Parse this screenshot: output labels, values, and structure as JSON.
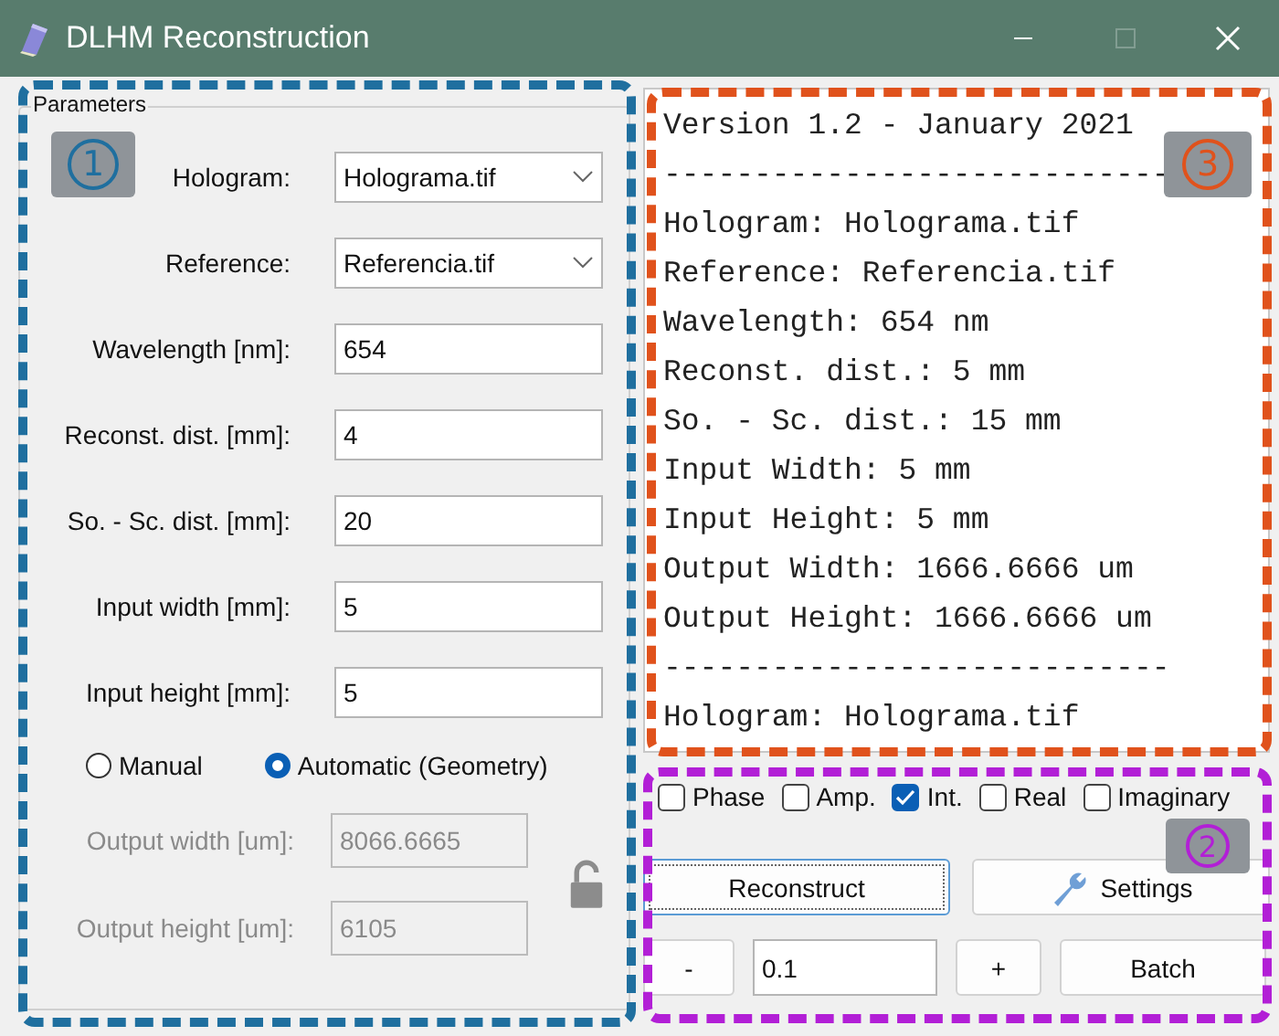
{
  "window": {
    "title": "DLHM Reconstruction",
    "maximize_disabled": true
  },
  "parameters": {
    "title": "Parameters",
    "fields": [
      {
        "kind": "dropdown",
        "label": "Hologram:",
        "value": "Holograma.tif"
      },
      {
        "kind": "dropdown",
        "label": "Reference:",
        "value": "Referencia.tif"
      },
      {
        "kind": "text",
        "label": "Wavelength [nm]:",
        "value": "654"
      },
      {
        "kind": "text",
        "label": "Reconst. dist. [mm]:",
        "value": "4"
      },
      {
        "kind": "text",
        "label": "So. - Sc. dist. [mm]:",
        "value": "20"
      },
      {
        "kind": "text",
        "label": "Input width [mm]:",
        "value": "5"
      },
      {
        "kind": "text",
        "label": "Input height [mm]:",
        "value": "5"
      }
    ],
    "modes": [
      {
        "label": "Manual",
        "selected": false
      },
      {
        "label": "Automatic (Geometry)",
        "selected": true
      }
    ],
    "output_fields": [
      {
        "label": "Output width [um]:",
        "value": "8066.6665",
        "disabled": true
      },
      {
        "label": "Output height [um]:",
        "value": "6105",
        "disabled": true
      }
    ],
    "lock": {
      "locked": false
    }
  },
  "log": {
    "lines": [
      "Version 1.2 - January 2021",
      "----------------------------",
      "Hologram: Holograma.tif",
      "Reference: Referencia.tif",
      "Wavelength: 654 nm",
      "Reconst. dist.: 5 mm",
      "So. - Sc. dist.: 15 mm",
      "Input Width: 5 mm",
      "Input Height: 5 mm",
      "Output Width: 1666.6666 um",
      "Output Height: 1666.6666 um",
      "----------------------------",
      "Hologram: Holograma.tif"
    ]
  },
  "views": [
    {
      "label": "Phase",
      "checked": false
    },
    {
      "label": "Amp.",
      "checked": false
    },
    {
      "label": "Int.",
      "checked": true
    },
    {
      "label": "Real",
      "checked": false
    },
    {
      "label": "Imaginary",
      "checked": false
    }
  ],
  "actions": {
    "reconstruct": "Reconstruct",
    "settings": "Settings"
  },
  "step": {
    "minus": "-",
    "value": "0.1",
    "plus": "+",
    "batch": "Batch"
  },
  "annotations": [
    {
      "label": "1",
      "color": "#1f6f9f"
    },
    {
      "label": "2",
      "color": "#b21fd6"
    },
    {
      "label": "3",
      "color": "#e0521c"
    }
  ]
}
